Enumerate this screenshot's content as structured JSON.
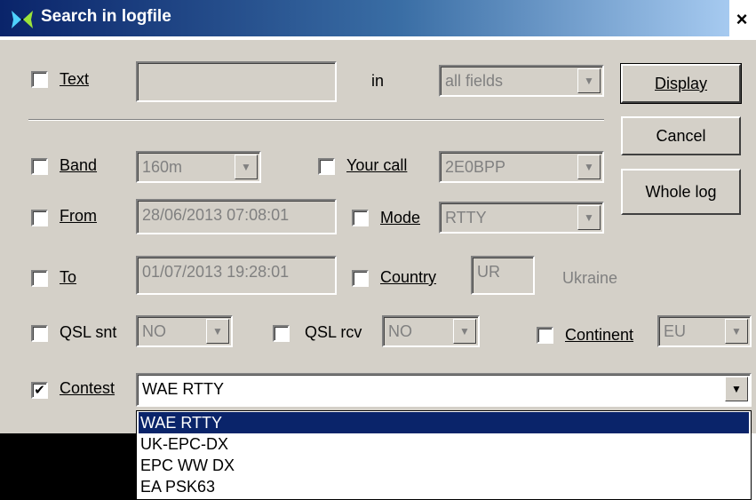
{
  "window": {
    "title": "Search in logfile",
    "close_label": "×"
  },
  "text_row": {
    "label": "Text",
    "value": "",
    "in_label": "in",
    "in_value": "all fields"
  },
  "buttons": {
    "display": "Display",
    "cancel": "Cancel",
    "whole_log": "Whole log"
  },
  "band": {
    "label": "Band",
    "value": "160m"
  },
  "your_call": {
    "label": "Your call",
    "value": "2E0BPP"
  },
  "from": {
    "label": "From",
    "value": "28/06/2013 07:08:01"
  },
  "mode": {
    "label": "Mode",
    "value": "RTTY"
  },
  "to": {
    "label": "To",
    "value": "01/07/2013 19:28:01"
  },
  "country": {
    "label": "Country",
    "value": "UR",
    "name": "Ukraine"
  },
  "qsl_snt": {
    "label": "QSL snt",
    "value": "NO"
  },
  "qsl_rcv": {
    "label": "QSL rcv",
    "value": "NO"
  },
  "continent": {
    "label": "Continent",
    "value": "EU"
  },
  "contest": {
    "label": "Contest",
    "checked": true,
    "value": "WAE RTTY",
    "options": [
      "WAE RTTY",
      "UK-EPC-DX",
      "EPC WW DX",
      "EA PSK63"
    ]
  }
}
